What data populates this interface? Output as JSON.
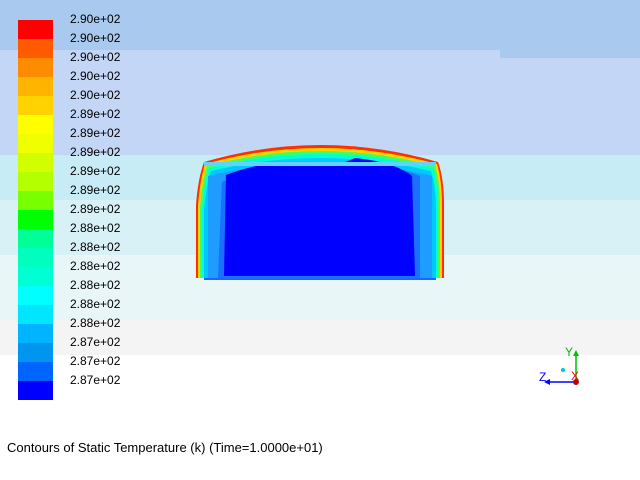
{
  "colorbar": {
    "labels": [
      "2.90e+02",
      "2.90e+02",
      "2.90e+02",
      "2.90e+02",
      "2.90e+02",
      "2.89e+02",
      "2.89e+02",
      "2.89e+02",
      "2.89e+02",
      "2.89e+02",
      "2.89e+02",
      "2.88e+02",
      "2.88e+02",
      "2.88e+02",
      "2.88e+02",
      "2.88e+02",
      "2.88e+02",
      "2.87e+02",
      "2.87e+02",
      "2.87e+02"
    ],
    "colors": [
      "#ff0000",
      "#ff5a00",
      "#ff8c00",
      "#ffb400",
      "#ffd200",
      "#ffff00",
      "#f0ff00",
      "#d2ff00",
      "#b4ff00",
      "#78ff00",
      "#00ff00",
      "#00ff96",
      "#00ffbe",
      "#00ffd2",
      "#00ffff",
      "#00e6ff",
      "#00b4ff",
      "#0096f0",
      "#0064ff",
      "#0000ff"
    ]
  },
  "caption": "Contours of Static Temperature (k)  (Time=1.0000e+01)",
  "axes": {
    "y_label": "Y",
    "z_label": "Z",
    "x_label": "X",
    "y_color": "#00c000",
    "z_color": "#0000ff",
    "x_color": "#ff0000"
  }
}
